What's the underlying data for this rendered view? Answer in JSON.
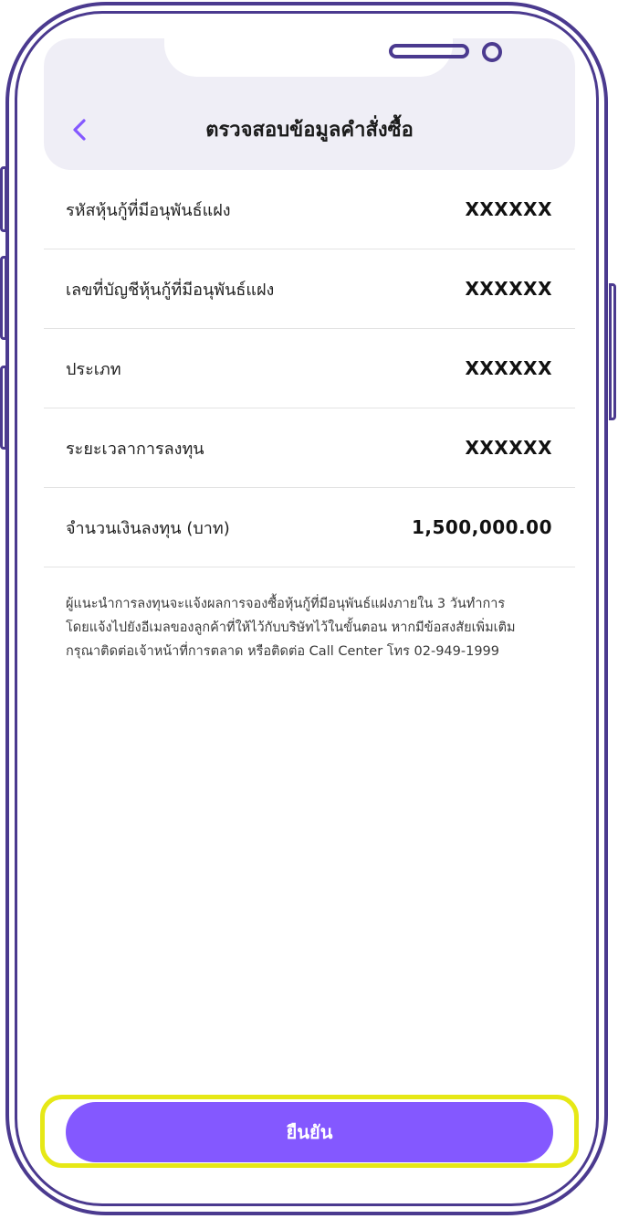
{
  "header": {
    "title": "ตรวจสอบข้อมูลคำสั่งซื้อ",
    "back_icon": "chevron-left-icon"
  },
  "details": [
    {
      "label": "รหัสหุ้นกู้ที่มีอนุพันธ์แฝง",
      "value": "XXXXXX"
    },
    {
      "label": "เลขที่บัญชีหุ้นกู้ที่มีอนุพันธ์แฝง",
      "value": "XXXXXX"
    },
    {
      "label": "ประเภท",
      "value": "XXXXXX"
    },
    {
      "label": "ระยะเวลาการลงทุน",
      "value": "XXXXXX"
    },
    {
      "label": "จำนวนเงินลงทุน (บาท)",
      "value": "1,500,000.00"
    }
  ],
  "note": {
    "line1": "ผู้แนะนำการลงทุนจะแจ้งผลการจองซื้อหุ้นกู้ที่มีอนุพันธ์แฝงภายใน 3 วันทำการ",
    "line2": "โดยแจ้งไปยังอีเมลของลูกค้าที่ให้ไว้กับบริษัทไว้ในขั้นตอน หากมีข้อสงสัยเพิ่มเติม",
    "line3": "กรุณาติดต่อเจ้าหน้าที่การตลาด หรือติดต่อ Call Center โทร 02-949-1999"
  },
  "actions": {
    "confirm_label": "ยืนยัน"
  },
  "colors": {
    "accent": "#8458ff",
    "frame": "#4b3a8f",
    "highlight": "#e6e816",
    "header_bg": "#efeef6"
  }
}
